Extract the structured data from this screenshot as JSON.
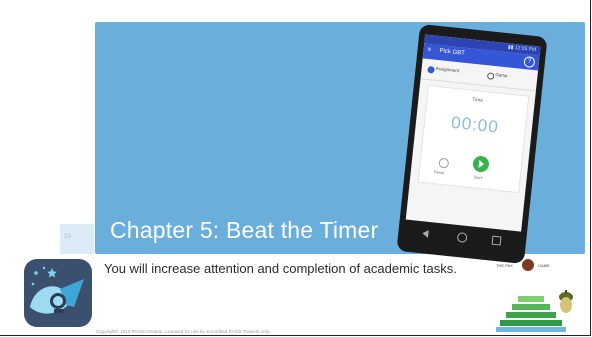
{
  "slide": {
    "number": "23",
    "title": "Chapter 5: Beat the Timer",
    "description": "You will increase attention and completion of academic tasks.",
    "copyright": "Copyright© 2019 PAXIS Institute. Licensed for use by accredited PAXIS Trainers only."
  },
  "phone_app": {
    "status_text": "▮▮ 12:05 PM",
    "title": "Pick GBT",
    "radio_assignment": "Assignment",
    "radio_game": "Game",
    "timer_label": "Time",
    "timer_value": "00:00",
    "reset_label": "Reset",
    "start_label": "Start"
  },
  "logo": {
    "left_text": "THE PAX",
    "right_text": "GAME"
  },
  "colors": {
    "banner": "#6aaedb",
    "app_bar": "#3556d6",
    "start_button": "#37b24d",
    "pyramid": "#2f9a46"
  },
  "icons": [
    "menu-icon",
    "help-icon",
    "play-icon",
    "reset-icon",
    "back-icon",
    "home-icon",
    "recent-apps-icon",
    "app-icon",
    "acorn-icon",
    "pyramid-graphic"
  ]
}
